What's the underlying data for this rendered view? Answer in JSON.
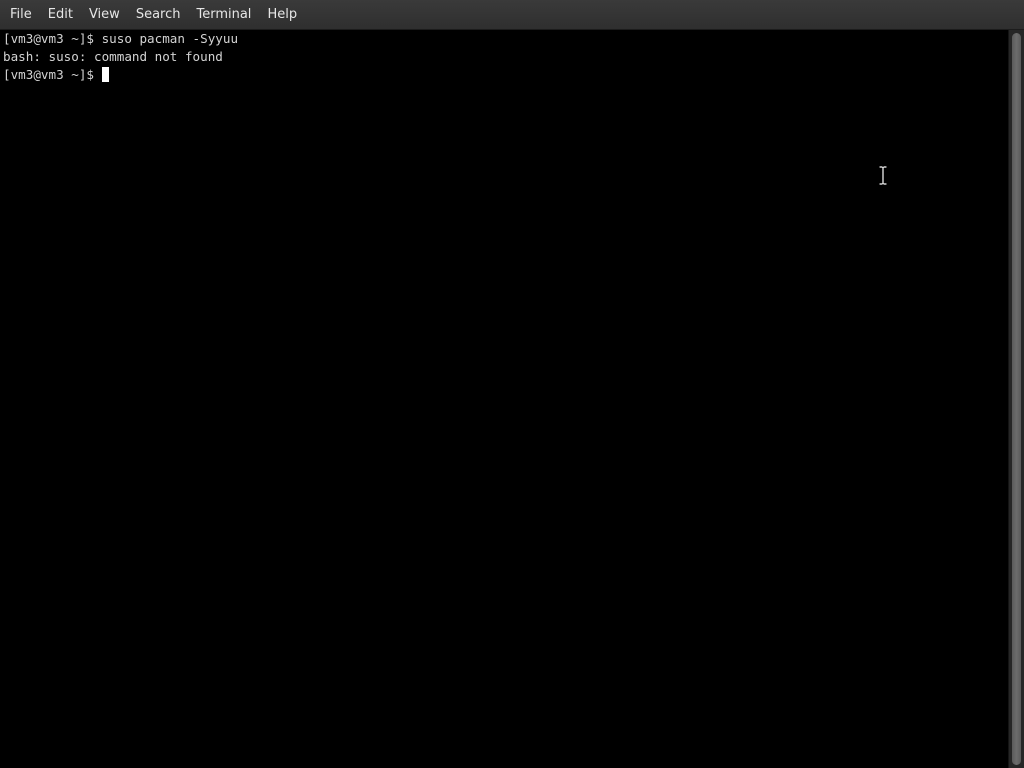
{
  "menubar": {
    "items": [
      "File",
      "Edit",
      "View",
      "Search",
      "Terminal",
      "Help"
    ]
  },
  "terminal": {
    "lines": [
      "[vm3@vm3 ~]$ suso pacman -Syyuu",
      "bash: suso: command not found",
      "[vm3@vm3 ~]$ "
    ],
    "background": "#000000",
    "foreground": "#d3d3d3"
  },
  "icons": {
    "mouse_cursor": "ibeam-cursor-icon",
    "text_cursor": "block-cursor"
  }
}
